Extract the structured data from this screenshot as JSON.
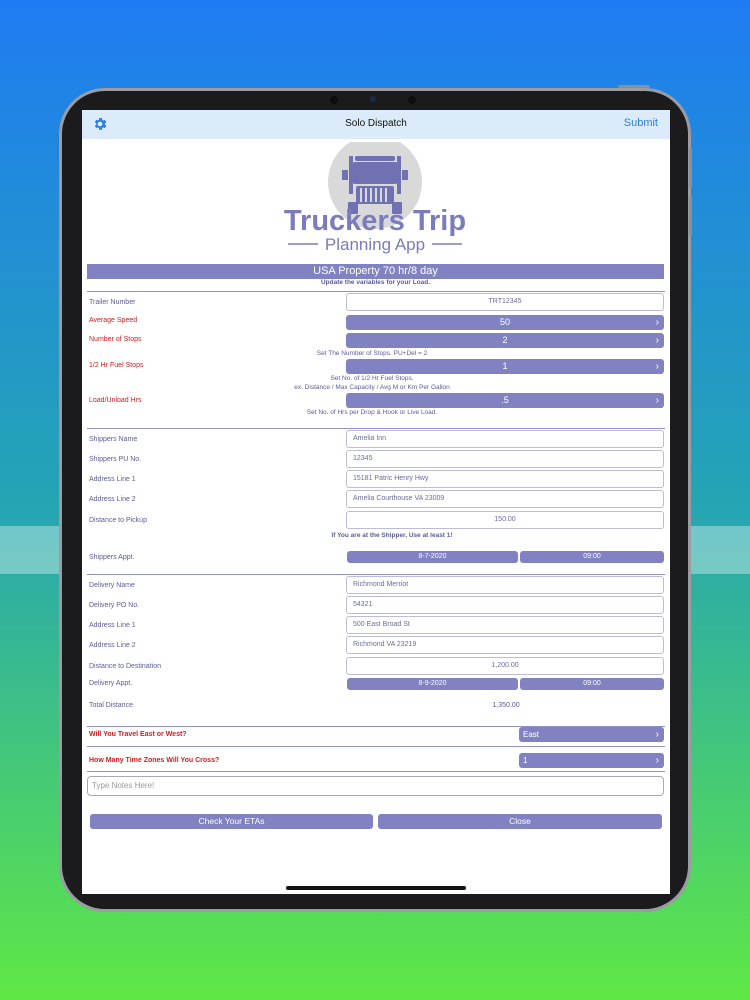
{
  "nav": {
    "title": "Solo Dispatch",
    "submit": "Submit",
    "settings_icon": "gear-icon"
  },
  "logo": {
    "line1": "Truckers Trip",
    "line2": "Planning App"
  },
  "banner": {
    "title": "USA Property 70 hr/8 day",
    "subtitle": "Update the variables for your Load."
  },
  "load": {
    "trailer_label": "Trailer Number",
    "trailer_value": "TRT12345",
    "speed_label": "Average Speed",
    "speed_value": "50",
    "stops_label": "Number of Stops",
    "stops_value": "2",
    "stops_hint": "Set The Number of Stops. PU+Del = 2",
    "fuel_label": "1/2 Hr Fuel Stops",
    "fuel_value": "1",
    "fuel_hint1": "Set No. of 1/2 Hr Fuel Stops.",
    "fuel_hint2": "ex. Distance / Max Capacity / Avg M or Km Per Gallon",
    "loadunload_label": "Load/Unload Hrs",
    "loadunload_value": ".5",
    "loadunload_hint": "Set No. of Hrs per Drop & Hook or Live Load."
  },
  "shipper": {
    "name_label": "Shippers Name",
    "name_value": "Amelia Inn",
    "pu_label": "Shippers PU No.",
    "pu_value": "12345",
    "addr1_label": "Address Line 1",
    "addr1_value": "15181 Patric Henry Hwy",
    "addr2_label": "Address Line 2",
    "addr2_value": "Amelia Courthouse VA 23009",
    "dist_label": "Distance to Pickup",
    "dist_value": "150.00",
    "dist_hint": "If You are at the Shipper, Use at least 1!",
    "appt_label": "Shippers Appt.",
    "appt_date": "8-7-2020",
    "appt_time": "09:00"
  },
  "delivery": {
    "name_label": "Delivery Name",
    "name_value": "Richmond Merriot",
    "po_label": "Delivery PO No.",
    "po_value": "54321",
    "addr1_label": "Address Line 1",
    "addr1_value": "500 East Broad St",
    "addr2_label": "Address Line 2",
    "addr2_value": "Richmond VA 23219",
    "dist_label": "Distance to Destination",
    "dist_value": "1,200.00",
    "appt_label": "Delivery Appt.",
    "appt_date": "8-9-2020",
    "appt_time": "09:00",
    "total_label": "Total Distance",
    "total_value": "1,350.00"
  },
  "travel": {
    "direction_label": "Will You Travel East or West?",
    "direction_value": "East",
    "zones_label": "How Many Time Zones Will You Cross?",
    "zones_value": "1"
  },
  "notes_placeholder": "Type Notes Here!",
  "buttons": {
    "check": "Check Your ETAs",
    "close": "Close"
  },
  "colors": {
    "accent": "#8082c2",
    "alert": "#d71a1a",
    "navbar": "#dcebf9"
  }
}
